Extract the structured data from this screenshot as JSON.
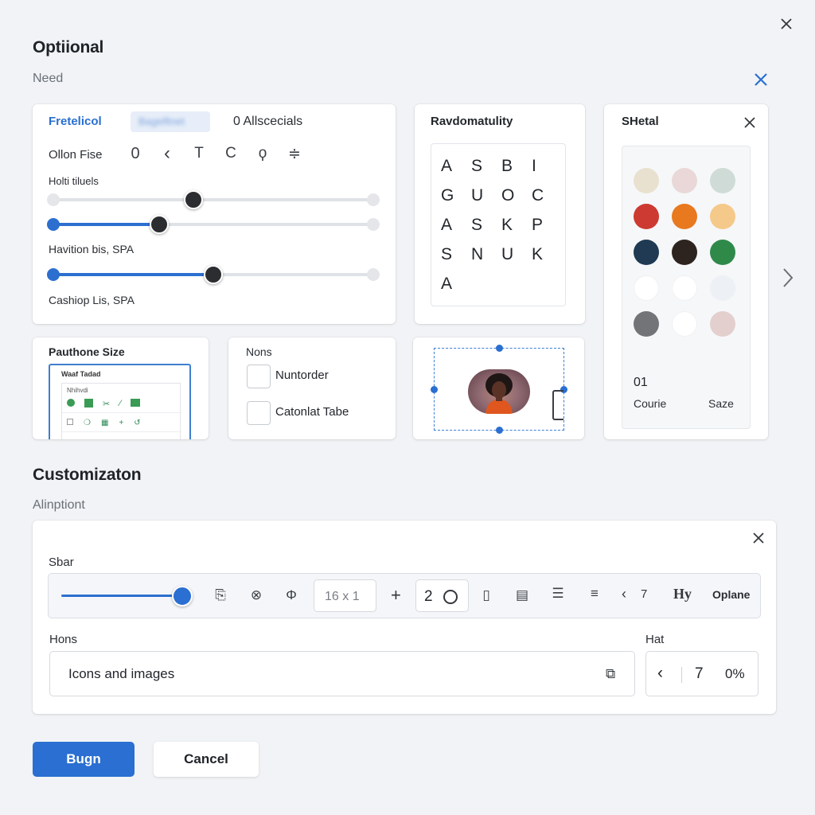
{
  "dialog": {
    "close_icon": "close-icon"
  },
  "optional": {
    "title": "Optiional",
    "subtitle": "Need"
  },
  "panel1": {
    "tab_active": "Fretelicol",
    "tab_blurred": "Bagelfinet",
    "tab_third": "0 Allscecials",
    "font_label": "Ollon Fise",
    "font_icons": [
      "0",
      "‹",
      "T",
      "C",
      "ϙ",
      "≑"
    ],
    "slider_label_1": "Holti tiluels",
    "slider_label_2": "Havition bis, SPA",
    "slider_label_3": "Cashiop Lis, SPA",
    "slider_values": [
      0.45,
      0.33,
      0.5
    ]
  },
  "panel2": {
    "title": "Ravdomatulity",
    "letters": [
      "A",
      "S",
      "B",
      "I",
      "G",
      "U",
      "O",
      "C",
      "A",
      "S",
      "K",
      "P",
      "S",
      "N",
      "U",
      "K",
      "A"
    ]
  },
  "panel3": {
    "title": "SHetal",
    "swatches": [
      "#e9e1cf",
      "#ead8d8",
      "#cfdbd6",
      "#cc3a31",
      "#e8791f",
      "#f5c98a",
      "#1f3a52",
      "#2d231f",
      "#2f8a4a",
      "#ffffff",
      "#ffffff",
      "#edf0f4",
      "#727478",
      "#ffffff",
      "#e4cfcf"
    ],
    "count": "01",
    "footer_left": "Courie",
    "footer_right": "Saze"
  },
  "panel4": {
    "title": "Pauthone Size",
    "thumb_title": "Waaf Tadad",
    "thumb_sub": "Nhihvdi"
  },
  "panel5": {
    "title": "Nons",
    "option1": "Nuntorder",
    "option2": "Catonlat Tabe"
  },
  "customization": {
    "title": "Customizaton",
    "subtitle": "Alinptiont"
  },
  "toolbar": {
    "label": "Sbar",
    "slider_value": 1.0,
    "dims": "16 x 1",
    "plus": "+",
    "count": "2",
    "lt": "‹",
    "seven": "7",
    "hy": "Hy",
    "option": "Oplane"
  },
  "icons_field": {
    "label": "Hons",
    "value": "Icons and images"
  },
  "hat_field": {
    "label": "Hat",
    "lt": "‹",
    "value": "7",
    "percent": "0%"
  },
  "actions": {
    "primary": "Bugn",
    "cancel": "Cancel"
  },
  "colors": {
    "accent": "#2a6fd1",
    "background": "#f1f3f6"
  }
}
